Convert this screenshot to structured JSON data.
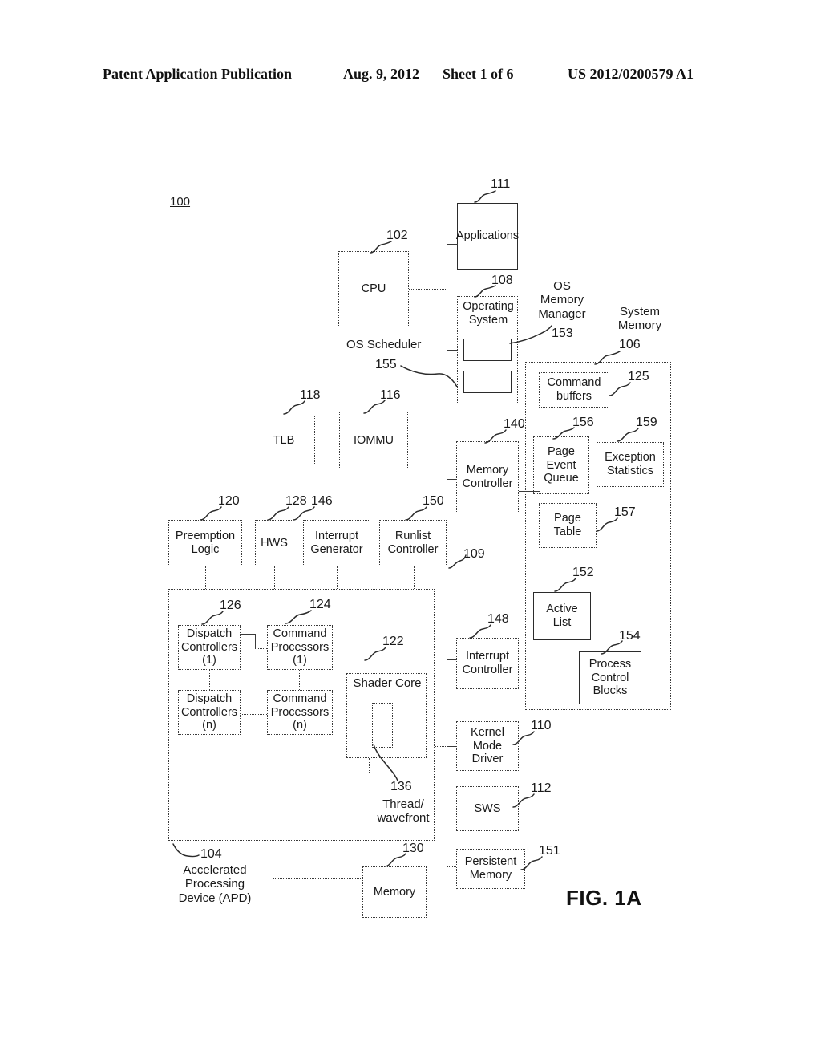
{
  "header": {
    "publication": "Patent Application Publication",
    "date": "Aug. 9, 2012",
    "sheet": "Sheet 1 of 6",
    "number": "US 2012/0200579 A1"
  },
  "figure": {
    "caption": "FIG. 1A",
    "system_ref": "100"
  },
  "blocks": {
    "applications": {
      "label": "Applications",
      "ref": "111"
    },
    "cpu": {
      "label": "CPU",
      "ref": "102"
    },
    "operating_system": {
      "label": "Operating\nSystem",
      "ref": "108"
    },
    "os_sub_upper": {
      "label": ""
    },
    "os_sub_lower": {
      "label": ""
    },
    "tlb": {
      "label": "TLB",
      "ref": "118"
    },
    "iommu": {
      "label": "IOMMU",
      "ref": "116"
    },
    "preemption_logic": {
      "label": "Preemption\nLogic",
      "ref": "120"
    },
    "hws": {
      "label": "HWS",
      "ref": "128"
    },
    "interrupt_generator": {
      "label": "Interrupt\nGenerator",
      "ref": "146"
    },
    "runlist_controller": {
      "label": "Runlist\nController",
      "ref": "150"
    },
    "dispatch_1": {
      "label": "Dispatch\nControllers\n(1)",
      "ref": "126"
    },
    "dispatch_n": {
      "label": "Dispatch\nControllers\n(n)",
      "ref": ""
    },
    "command_proc_1": {
      "label": "Command\nProcessors\n(1)",
      "ref": "124"
    },
    "command_proc_n": {
      "label": "Command\nProcessors\n(n)",
      "ref": ""
    },
    "shader_core": {
      "label": "Shader Core",
      "ref": "122"
    },
    "thread_wavefront": {
      "label": "Thread/\nwavefront",
      "ref": "136"
    },
    "apd": {
      "label": "Accelerated\nProcessing\nDevice (APD)",
      "ref": "104"
    },
    "memory": {
      "label": "Memory",
      "ref": "130"
    },
    "memory_controller": {
      "label": "Memory\nController",
      "ref": "140"
    },
    "interrupt_controller": {
      "label": "Interrupt\nController",
      "ref": "148"
    },
    "kernel_mode_driver": {
      "label": "Kernel\nMode\nDriver",
      "ref": "110"
    },
    "sws": {
      "label": "SWS",
      "ref": "112"
    },
    "persistent_memory": {
      "label": "Persistent\nMemory",
      "ref": "151"
    },
    "system_memory": {
      "label": "System\nMemory",
      "ref": "106"
    },
    "command_buffers": {
      "label": "Command\nbuffers",
      "ref": "125"
    },
    "page_event_queue": {
      "label": "Page\nEvent\nQueue",
      "ref": "156"
    },
    "exception_statistics": {
      "label": "Exception\nStatistics",
      "ref": "159"
    },
    "page_table": {
      "label": "Page\nTable",
      "ref": "157"
    },
    "active_list": {
      "label": "Active\nList",
      "ref": "152"
    },
    "process_control_blocks": {
      "label": "Process\nControl\nBlocks",
      "ref": "154"
    }
  },
  "annotations": {
    "os_memory_manager": {
      "label": "OS\nMemory\nManager",
      "ref": "153"
    },
    "os_scheduler": {
      "label": "OS Scheduler",
      "ref": "155"
    },
    "bus": {
      "ref": "109"
    }
  },
  "colors": {
    "ink": "#1a1a1a",
    "line": "#3a3a3a",
    "paper": "#ffffff"
  }
}
